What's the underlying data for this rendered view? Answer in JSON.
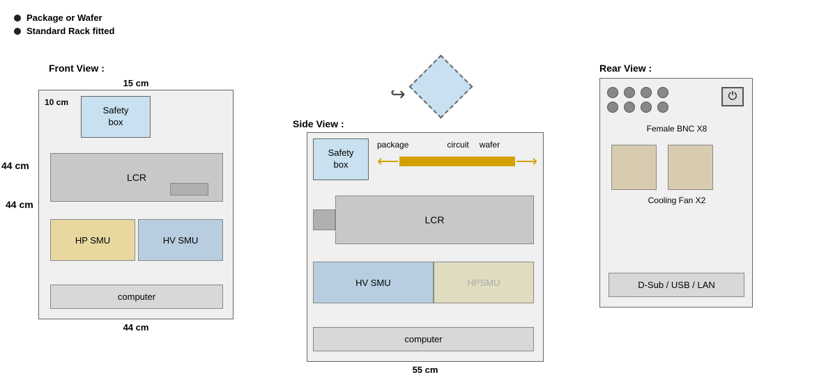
{
  "legend": {
    "item1": "Package or Wafer",
    "item2": "Standard Rack fitted"
  },
  "frontView": {
    "label": "Front View :",
    "dimTop": "15 cm",
    "dim10cm": "10 cm",
    "dimLeft": "44 cm",
    "dimBottom": "44 cm",
    "safetyBox": "Safety\nbox",
    "lcr": "LCR",
    "hpSmu": "HP SMU",
    "hvSmu": "HV SMU",
    "computer": "computer"
  },
  "sideView": {
    "label": "Side View :",
    "dimBottom": "55 cm",
    "safetyBox": "Safety\nbox",
    "packageLabel": "package",
    "circuitLabel": "circuit",
    "waferLabel": "wafer",
    "lcr": "LCR",
    "hvSmu": "HV SMU",
    "hpSmu": "HPSMU",
    "computer": "computer"
  },
  "rearView": {
    "label": "Rear View :",
    "femaleBnc": "Female BNC X8",
    "coolingFan": "Cooling Fan X2",
    "dSub": "D-Sub / USB / LAN"
  },
  "dimLeft44": "44 cm"
}
